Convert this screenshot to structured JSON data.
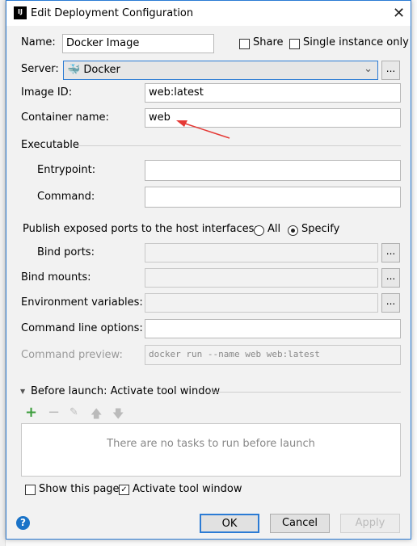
{
  "window": {
    "title": "Edit Deployment Configuration",
    "app_icon": "IJ"
  },
  "name": {
    "label": "Name:",
    "value": "Docker Image"
  },
  "share": {
    "label": "Share",
    "checked": false
  },
  "single_instance": {
    "label": "Single instance only",
    "checked": false
  },
  "server": {
    "label": "Server:",
    "value": "Docker",
    "more": "..."
  },
  "image_id": {
    "label": "Image ID:",
    "value": "web:latest"
  },
  "container_name": {
    "label": "Container name:",
    "value": "web"
  },
  "executable": {
    "label": "Executable",
    "entrypoint_label": "Entrypoint:",
    "entrypoint_value": "",
    "command_label": "Command:",
    "command_value": ""
  },
  "publish": {
    "label": "Publish exposed ports to the host interfaces:",
    "all": "All",
    "specify": "Specify",
    "selected": "Specify"
  },
  "bind_ports": {
    "label": "Bind ports:",
    "value": "",
    "more": "..."
  },
  "bind_mounts": {
    "label": "Bind mounts:",
    "value": "",
    "more": "..."
  },
  "env_vars": {
    "label": "Environment variables:",
    "value": "",
    "more": "..."
  },
  "cmd_options": {
    "label": "Command line options:",
    "value": ""
  },
  "cmd_preview": {
    "label": "Command preview:",
    "value": "docker run --name web web:latest"
  },
  "before_launch": {
    "label": "Before launch: Activate tool window",
    "empty_text": "There are no tasks to run before launch"
  },
  "show_page": {
    "label": "Show this page",
    "checked": false
  },
  "activate_tool": {
    "label": "Activate tool window",
    "checked": true
  },
  "buttons": {
    "ok": "OK",
    "cancel": "Cancel",
    "apply": "Apply",
    "help": "?"
  },
  "colors": {
    "accent": "#2b7bd4",
    "add": "#3c9d3c",
    "arrow": "#e53935"
  }
}
